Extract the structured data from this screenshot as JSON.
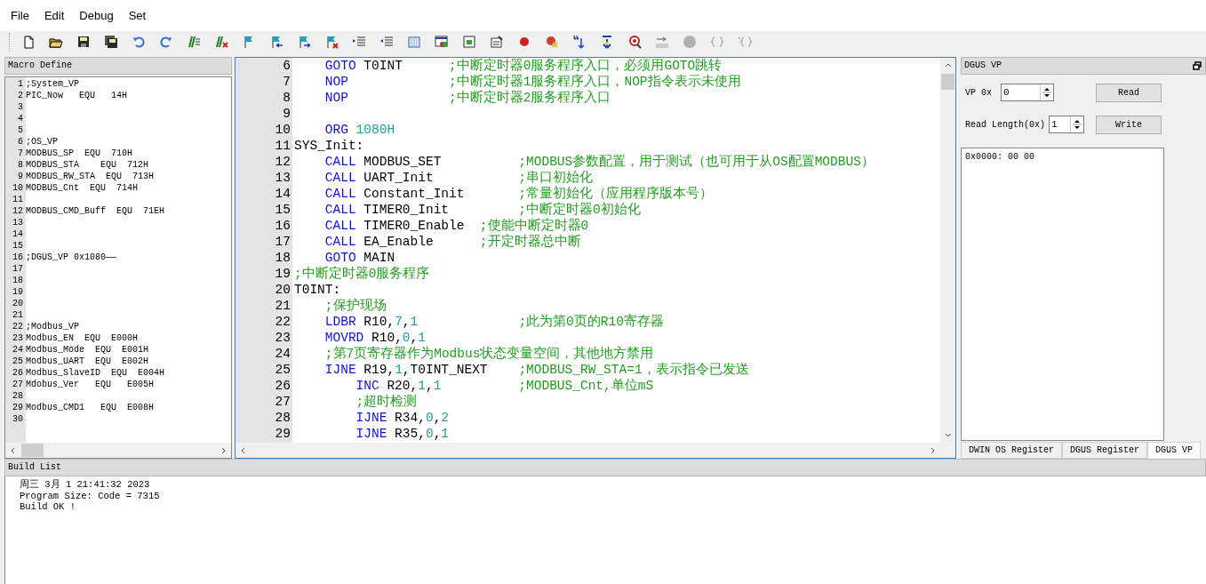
{
  "menu": [
    "File",
    "Edit",
    "Debug",
    "Set"
  ],
  "macro_panel": {
    "title": "Macro Define",
    "lines": [
      {
        "number": "1",
        "text": ";System_VP"
      },
      {
        "number": "2",
        "text": "PIC_Now   EQU   14H"
      },
      {
        "number": "3"
      },
      {
        "number": "4"
      },
      {
        "number": "5"
      },
      {
        "number": "6",
        "text": ";OS_VP"
      },
      {
        "number": "7",
        "text": "MODBUS_SP  EQU  710H"
      },
      {
        "number": "8",
        "text": "MODBUS_STA    EQU  712H"
      },
      {
        "number": "9",
        "text": "MODBUS_RW_STA  EQU  713H"
      },
      {
        "number": "10",
        "text": "MODBUS_Cnt  EQU  714H"
      },
      {
        "number": "11"
      },
      {
        "number": "12",
        "text": "MODBUS_CMD_Buff  EQU  71EH"
      },
      {
        "number": "13"
      },
      {
        "number": "14"
      },
      {
        "number": "15"
      },
      {
        "number": "16",
        "text": ";DGUS_VP 0x1080——"
      },
      {
        "number": "17"
      },
      {
        "number": "18"
      },
      {
        "number": "19"
      },
      {
        "number": "20"
      },
      {
        "number": "21"
      },
      {
        "number": "22",
        "text": ";Modbus_VP"
      },
      {
        "number": "23",
        "text": "Modbus_EN  EQU  E000H"
      },
      {
        "number": "24",
        "text": "Modbus_Mode  EQU  E001H"
      },
      {
        "number": "25",
        "text": "Modbus_UART  EQU  E002H"
      },
      {
        "number": "26",
        "text": "Modbus_SlaveID  EQU  E004H"
      },
      {
        "number": "27",
        "text": "Mdobus_Ver   EQU   E005H"
      },
      {
        "number": "28"
      },
      {
        "number": "29",
        "text": "Modbus_CMD1   EQU  E008H"
      },
      {
        "number": "30"
      }
    ]
  },
  "editor": {
    "lines": [
      {
        "number": "6",
        "tokens": [
          {
            "kind": "keyword",
            "text": "    GOTO"
          },
          {
            "kind": "plain",
            "text": " T0INT      "
          },
          {
            "kind": "comment",
            "text": ";中断定时器0服务程序入口，必须用GOTO跳转"
          }
        ]
      },
      {
        "number": "7",
        "tokens": [
          {
            "kind": "keyword",
            "text": "    NOP             "
          },
          {
            "kind": "comment",
            "text": ";中断定时器1服务程序入口，NOP指令表示未使用"
          }
        ]
      },
      {
        "number": "8",
        "tokens": [
          {
            "kind": "keyword",
            "text": "    NOP             "
          },
          {
            "kind": "comment",
            "text": ";中断定时器2服务程序入口"
          }
        ]
      },
      {
        "number": "9"
      },
      {
        "number": "10",
        "tokens": [
          {
            "kind": "keyword",
            "text": "    ORG"
          },
          {
            "kind": "number",
            "text": " 1080H"
          }
        ]
      },
      {
        "number": "11",
        "tokens": [
          {
            "kind": "plain",
            "text": "SYS_Init:"
          }
        ]
      },
      {
        "number": "12",
        "tokens": [
          {
            "kind": "keyword",
            "text": "    CALL"
          },
          {
            "kind": "plain",
            "text": " MODBUS_SET          "
          },
          {
            "kind": "comment",
            "text": ";MODBUS参数配置，用于测试（也可用于从OS配置MODBUS）"
          }
        ]
      },
      {
        "number": "13",
        "tokens": [
          {
            "kind": "keyword",
            "text": "    CALL"
          },
          {
            "kind": "plain",
            "text": " UART_Init           "
          },
          {
            "kind": "comment",
            "text": ";串口初始化"
          }
        ]
      },
      {
        "number": "14",
        "tokens": [
          {
            "kind": "keyword",
            "text": "    CALL"
          },
          {
            "kind": "plain",
            "text": " Constant_Init       "
          },
          {
            "kind": "comment",
            "text": ";常量初始化（应用程序版本号）"
          }
        ]
      },
      {
        "number": "15",
        "tokens": [
          {
            "kind": "keyword",
            "text": "    CALL"
          },
          {
            "kind": "plain",
            "text": " TIMER0_Init         "
          },
          {
            "kind": "comment",
            "text": ";中断定时器0初始化"
          }
        ]
      },
      {
        "number": "16",
        "tokens": [
          {
            "kind": "keyword",
            "text": "    CALL"
          },
          {
            "kind": "plain",
            "text": " TIMER0_Enable  "
          },
          {
            "kind": "comment",
            "text": ";使能中断定时器0"
          }
        ]
      },
      {
        "number": "17",
        "tokens": [
          {
            "kind": "keyword",
            "text": "    CALL"
          },
          {
            "kind": "plain",
            "text": " EA_Enable      "
          },
          {
            "kind": "comment",
            "text": ";开定时器总中断"
          }
        ]
      },
      {
        "number": "18",
        "tokens": [
          {
            "kind": "keyword",
            "text": "    GOTO"
          },
          {
            "kind": "plain",
            "text": " MAIN"
          }
        ]
      },
      {
        "number": "19",
        "tokens": [
          {
            "kind": "comment",
            "text": ";中断定时器0服务程序"
          }
        ]
      },
      {
        "number": "20",
        "tokens": [
          {
            "kind": "plain",
            "text": "T0INT:"
          }
        ]
      },
      {
        "number": "21",
        "tokens": [
          {
            "kind": "comment",
            "text": "    ;保护现场"
          }
        ]
      },
      {
        "number": "22",
        "tokens": [
          {
            "kind": "keyword",
            "text": "    LDBR"
          },
          {
            "kind": "plain",
            "text": " R10,"
          },
          {
            "kind": "number",
            "text": "7"
          },
          {
            "kind": "plain",
            "text": ","
          },
          {
            "kind": "number",
            "text": "1             "
          },
          {
            "kind": "comment",
            "text": ";此为第0页的R10寄存器"
          }
        ]
      },
      {
        "number": "23",
        "tokens": [
          {
            "kind": "keyword",
            "text": "    MOVRD"
          },
          {
            "kind": "plain",
            "text": " R10,"
          },
          {
            "kind": "number",
            "text": "0"
          },
          {
            "kind": "plain",
            "text": ","
          },
          {
            "kind": "number",
            "text": "1"
          }
        ]
      },
      {
        "number": "24",
        "tokens": [
          {
            "kind": "comment",
            "text": "    ;第7页寄存器作为Modbus状态变量空间，其他地方禁用"
          }
        ]
      },
      {
        "number": "25",
        "tokens": [
          {
            "kind": "keyword",
            "text": "    IJNE"
          },
          {
            "kind": "plain",
            "text": " R19,"
          },
          {
            "kind": "number",
            "text": "1"
          },
          {
            "kind": "plain",
            "text": ",T0INT_NEXT    "
          },
          {
            "kind": "comment",
            "text": ";MODBUS_RW_STA=1，表示指令已发送"
          }
        ]
      },
      {
        "number": "26",
        "tokens": [
          {
            "kind": "keyword",
            "text": "        INC"
          },
          {
            "kind": "plain",
            "text": " R20,"
          },
          {
            "kind": "number",
            "text": "1"
          },
          {
            "kind": "plain",
            "text": ","
          },
          {
            "kind": "number",
            "text": "1          "
          },
          {
            "kind": "comment",
            "text": ";MODBUS_Cnt,单位mS"
          }
        ]
      },
      {
        "number": "27",
        "tokens": [
          {
            "kind": "comment",
            "text": "        ;超时检测"
          }
        ]
      },
      {
        "number": "28",
        "tokens": [
          {
            "kind": "keyword",
            "text": "        IJNE"
          },
          {
            "kind": "plain",
            "text": " R34,"
          },
          {
            "kind": "number",
            "text": "0"
          },
          {
            "kind": "plain",
            "text": ","
          },
          {
            "kind": "number",
            "text": "2"
          }
        ]
      },
      {
        "number": "29",
        "tokens": [
          {
            "kind": "keyword",
            "text": "        IJNE"
          },
          {
            "kind": "plain",
            "text": " R35,"
          },
          {
            "kind": "number",
            "text": "0"
          },
          {
            "kind": "plain",
            "text": ","
          },
          {
            "kind": "number",
            "text": "1"
          }
        ]
      }
    ]
  },
  "vp_panel": {
    "title": "DGUS VP",
    "vp_label": "VP 0x",
    "vp_value": "0",
    "read_button": "Read",
    "length_label": "Read Length(0x)",
    "length_value": "1",
    "write_button": "Write",
    "output": "0x0000: 00 00",
    "tabs": [
      {
        "label": "DWIN OS Register",
        "selected": false
      },
      {
        "label": "DGUS Register",
        "selected": false
      },
      {
        "label": "DGUS VP",
        "selected": true
      }
    ]
  },
  "build_list": {
    "title": "Build List",
    "lines": [
      "周三 3月 1 21:41:32 2023",
      "Program Size: Code = 7315",
      "Build OK !"
    ]
  }
}
